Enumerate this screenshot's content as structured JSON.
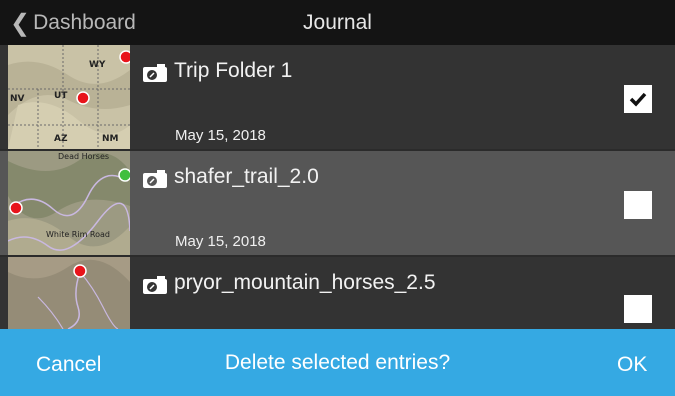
{
  "header": {
    "back_label": "Dashboard",
    "title": "Journal"
  },
  "entries": [
    {
      "title": "Trip Folder 1",
      "date": "May 15, 2018",
      "checked": true,
      "map_labels": [
        "WY",
        "NV",
        "UT",
        "AZ",
        "NM"
      ]
    },
    {
      "title": "shafer_trail_2.0",
      "date": "May 15, 2018",
      "checked": false,
      "map_labels": [
        "Dead Horses",
        "White Rim Road"
      ]
    },
    {
      "title": "pryor_mountain_horses_2.5",
      "date": "",
      "checked": false,
      "map_labels": []
    }
  ],
  "dialog": {
    "cancel_label": "Cancel",
    "prompt": "Delete selected entries?",
    "ok_label": "OK"
  },
  "colors": {
    "topbar": "#141414",
    "row": "#333333",
    "row_alt": "#565656",
    "accent": "#35a9e3",
    "marker_red": "#e8141b",
    "marker_green": "#3fbf3f"
  },
  "icons": {
    "back": "chevron-left-icon",
    "entry": "camera-icon",
    "check": "checkmark-icon"
  }
}
